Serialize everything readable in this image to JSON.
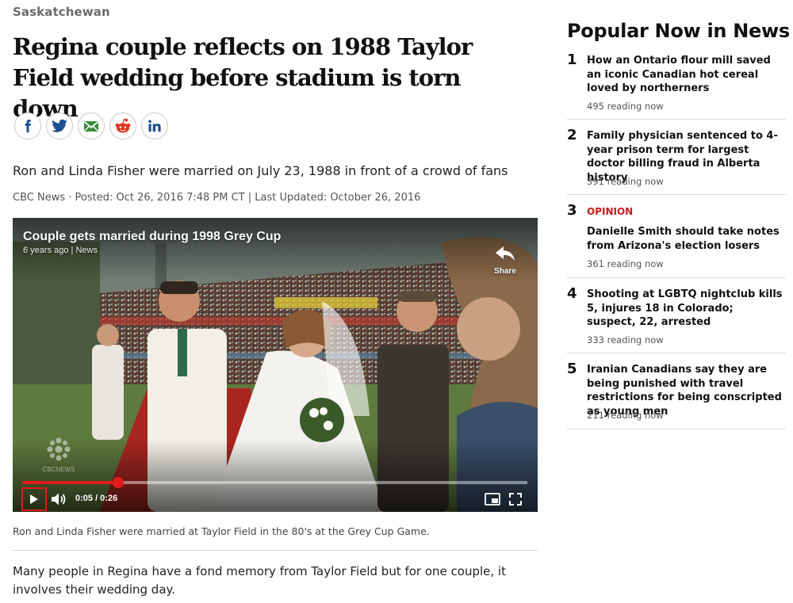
{
  "article": {
    "section": "Saskatchewan",
    "headline": "Regina couple reflects on 1988 Taylor Field wedding before stadium is torn down",
    "deck": "Ron and Linda Fisher were married on July 23, 1988 in front of a crowd of fans",
    "byline": "CBC News · Posted: Oct 26, 2016 7:48 PM CT | Last Updated: October 26, 2016",
    "share_icons": [
      "facebook-icon",
      "twitter-icon",
      "email-icon",
      "reddit-icon",
      "linkedin-icon"
    ],
    "video": {
      "title": "Couple gets married during 1998 Grey Cup",
      "meta": "6 years ago | News",
      "share_label": "Share",
      "watermark": "CBCNEWS",
      "current_time": "0:05",
      "duration": "0:26",
      "time_display": "0:05 / 0:26",
      "progress_fraction": 0.19,
      "accent_color": "#e01b1b"
    },
    "caption": "Ron and Linda Fisher were married at Taylor Field in the 80's at the Grey Cup Game.",
    "body_paragraph": "Many people in Regina have a fond memory from Taylor Field but for one couple, it involves their wedding day."
  },
  "sidebar": {
    "title": "Popular Now in News",
    "items": [
      {
        "rank": "1",
        "tag": "",
        "headline": "How an Ontario flour mill saved an iconic Canadian hot cereal loved by northerners",
        "count": "495 reading now"
      },
      {
        "rank": "2",
        "tag": "",
        "headline": "Family physician sentenced to 4-year prison term for largest doctor billing fraud in Alberta history",
        "count": "391 reading now"
      },
      {
        "rank": "3",
        "tag": "OPINION",
        "headline": "Danielle Smith should take notes from Arizona's election losers",
        "count": "361 reading now"
      },
      {
        "rank": "4",
        "tag": "",
        "headline": "Shooting at LGBTQ nightclub kills 5, injures 18 in Colorado; suspect, 22, arrested",
        "count": "333 reading now"
      },
      {
        "rank": "5",
        "tag": "",
        "headline": "Iranian Canadians say they are being punished with travel restrictions for being conscripted as young men",
        "count": "211 reading now"
      }
    ]
  }
}
